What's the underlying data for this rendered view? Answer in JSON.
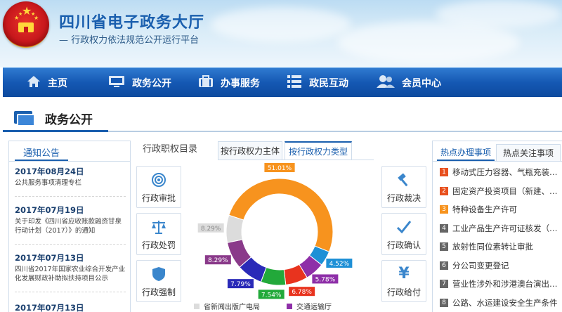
{
  "header": {
    "title": "四川省电子政务大厅",
    "subtitle": "— 行政权力依法规范公开运行平台"
  },
  "nav": {
    "items": [
      {
        "label": "主页",
        "icon": "home-icon"
      },
      {
        "label": "政务公开",
        "icon": "monitor-icon"
      },
      {
        "label": "办事服务",
        "icon": "briefcase-icon"
      },
      {
        "label": "政民互动",
        "icon": "list-icon"
      },
      {
        "label": "会员中心",
        "icon": "users-icon"
      }
    ]
  },
  "section": {
    "title": "政务公开"
  },
  "notice": {
    "tab": "通知公告",
    "items": [
      {
        "date": "2017年08月24日",
        "text": "公共服务事项清理专栏"
      },
      {
        "date": "2017年07月19日",
        "text": "关于印发《四川省应收账款融资甘泉行动计划（2017）》的通知"
      },
      {
        "date": "2017年07月13日",
        "text": "四川省2017年国家农业综合开发产业化发展财政补助拟扶持项目公示"
      },
      {
        "date": "2017年07月13日",
        "text": ""
      }
    ]
  },
  "middle": {
    "label": "行政职权目录",
    "tabs": [
      "按行政权力主体",
      "按行政权力类型"
    ],
    "left_buttons": [
      {
        "label": "行政审批",
        "icon": "target-icon"
      },
      {
        "label": "行政处罚",
        "icon": "scales-icon"
      },
      {
        "label": "行政强制",
        "icon": "shield-icon"
      }
    ],
    "right_buttons": [
      {
        "label": "行政裁决",
        "icon": "gavel-icon"
      },
      {
        "label": "行政确认",
        "icon": "checkmark-icon"
      },
      {
        "label": "行政给付",
        "icon": "yen-icon"
      }
    ]
  },
  "chart_data": {
    "type": "pie",
    "values": [
      51.01,
      4.52,
      5.78,
      6.78,
      7.54,
      7.79,
      8.29,
      8.29
    ],
    "labels": [
      "51.01%",
      "4.52%",
      "5.78%",
      "6.78%",
      "7.54%",
      "7.79%",
      "8.29%",
      "8.29%"
    ],
    "colors": [
      "#f7931e",
      "#1e90d6",
      "#8e2fa8",
      "#e8331e",
      "#22a93a",
      "#2a2ab8",
      "#8a3a8a",
      "#dcdcdc"
    ],
    "legend": [
      {
        "name": "省新闻出版广电局",
        "color": "#dcdcdc"
      },
      {
        "name": "交通运输厅",
        "color": "#8e2fa8"
      }
    ]
  },
  "hot": {
    "tabs": [
      "热点办理事项",
      "热点关注事项"
    ],
    "items": [
      {
        "num": "1",
        "text": "移动式压力容器、气瓶充装许可",
        "color": "#e8501e"
      },
      {
        "num": "2",
        "text": "固定资产投资项目（新建、扩建）",
        "color": "#e8501e"
      },
      {
        "num": "3",
        "text": "特种设备生产许可",
        "color": "#f7931e"
      },
      {
        "num": "4",
        "text": "工业产品生产许可证核发（省级）",
        "color": "#666666"
      },
      {
        "num": "5",
        "text": "放射性同位素转让审批",
        "color": "#666666"
      },
      {
        "num": "6",
        "text": "分公司变更登记",
        "color": "#666666"
      },
      {
        "num": "7",
        "text": "营业性涉外和涉港澳台演出审批",
        "color": "#666666"
      },
      {
        "num": "8",
        "text": "公路、水运建设安全生产条件",
        "color": "#666666"
      }
    ]
  }
}
